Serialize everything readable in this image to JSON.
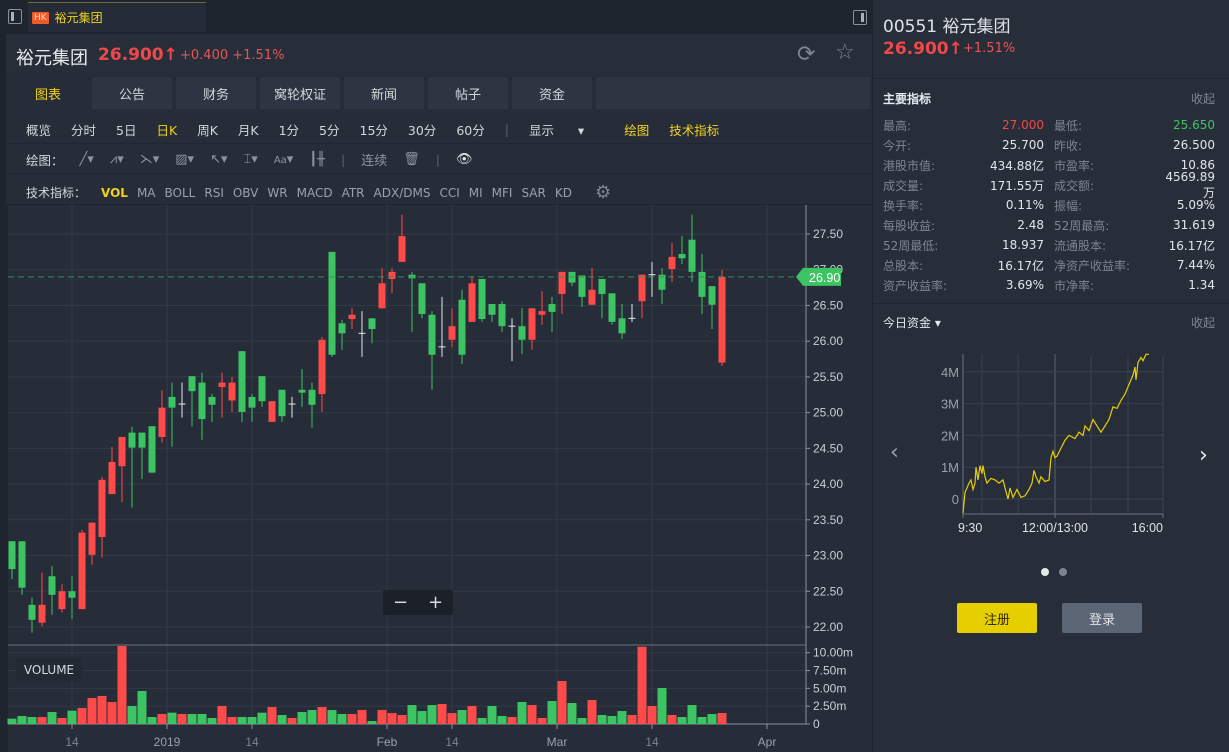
{
  "window_tab": {
    "market_badge": "HK",
    "label": "裕元集团"
  },
  "header": {
    "name": "裕元集团",
    "price": "26.900",
    "arrow": "↑",
    "change": "+0.400",
    "change_pct": "+1.51%"
  },
  "nav_tabs": [
    "图表",
    "公告",
    "财务",
    "窝轮权证",
    "新闻",
    "帖子",
    "资金"
  ],
  "periods": [
    "概览",
    "分时",
    "5日",
    "日K",
    "周K",
    "月K",
    "1分",
    "5分",
    "15分",
    "30分",
    "60分"
  ],
  "period_active": "日K",
  "toolbar": {
    "display": "显示",
    "draw": "绘图",
    "indicators": "技术指标"
  },
  "draw_row": {
    "label": "绘图：",
    "continuous": "连续",
    "font_size_tool": "Aa"
  },
  "indicator_row": {
    "label": "技术指标：",
    "items": [
      "VOL",
      "MA",
      "BOLL",
      "RSI",
      "OBV",
      "WR",
      "MACD",
      "ATR",
      "ADX/DMS",
      "CCI",
      "MI",
      "MFI",
      "SAR",
      "KD"
    ],
    "active": "VOL"
  },
  "volume_label": "VOLUME",
  "zoom": {
    "minus": "−",
    "plus": "+"
  },
  "colors": {
    "up": "#ff4a4a",
    "down": "#3cc462",
    "accent": "#f2d21c",
    "last_price_tag": "#3cc462"
  },
  "chart_data": {
    "type": "candlestick",
    "last_price": 26.9,
    "last_price_label": "26.90",
    "price_ticks": [
      "27.50",
      "27.00",
      "26.50",
      "26.00",
      "25.50",
      "25.00",
      "24.50",
      "24.00",
      "23.50",
      "23.00",
      "22.50",
      "22.00"
    ],
    "volume_ticks": [
      "10.00m",
      "7.50m",
      "5.00m",
      "2.50m",
      "0"
    ],
    "x_ticks": [
      "14",
      "2019",
      "14",
      "Feb",
      "14",
      "Mar",
      "14",
      "Apr"
    ],
    "ohlc": [
      [
        23.2,
        23.2,
        22.67,
        22.81
      ],
      [
        23.2,
        23.2,
        22.45,
        22.55
      ],
      [
        22.31,
        22.41,
        21.92,
        22.1
      ],
      [
        22.06,
        22.76,
        22.01,
        22.31
      ],
      [
        22.71,
        22.85,
        22.17,
        22.45
      ],
      [
        22.25,
        22.6,
        22.2,
        22.5
      ],
      [
        22.5,
        22.71,
        22.11,
        22.41
      ],
      [
        22.25,
        23.36,
        22.25,
        23.32
      ],
      [
        23.01,
        23.46,
        22.87,
        23.46
      ],
      [
        23.26,
        24.1,
        22.97,
        24.06
      ],
      [
        23.86,
        24.52,
        23.86,
        24.31
      ],
      [
        24.25,
        24.66,
        23.75,
        24.66
      ],
      [
        24.72,
        24.8,
        23.67,
        24.51
      ],
      [
        24.72,
        24.72,
        24.07,
        24.51
      ],
      [
        24.81,
        24.81,
        24.16,
        24.16
      ],
      [
        24.66,
        25.31,
        24.58,
        25.07
      ],
      [
        25.22,
        25.42,
        24.52,
        25.07
      ],
      [
        25.12,
        25.42,
        24.93,
        25.12
      ],
      [
        25.51,
        25.51,
        24.81,
        25.3
      ],
      [
        25.42,
        25.56,
        24.62,
        24.91
      ],
      [
        25.22,
        25.26,
        24.87,
        25.11
      ],
      [
        25.36,
        25.56,
        24.93,
        25.42
      ],
      [
        25.17,
        25.5,
        25.01,
        25.42
      ],
      [
        25.86,
        25.86,
        24.87,
        25.01
      ],
      [
        25.22,
        25.26,
        24.87,
        25.07
      ],
      [
        25.51,
        25.51,
        25.08,
        25.16
      ],
      [
        24.87,
        25.16,
        24.87,
        25.16
      ],
      [
        25.32,
        25.32,
        24.87,
        24.95
      ],
      [
        25.12,
        25.22,
        24.93,
        25.12
      ],
      [
        25.32,
        25.61,
        25.08,
        25.28
      ],
      [
        25.32,
        25.42,
        24.79,
        25.11
      ],
      [
        25.26,
        26.06,
        25.01,
        26.02
      ],
      [
        27.25,
        27.25,
        25.78,
        25.81
      ],
      [
        26.25,
        26.3,
        25.88,
        26.11
      ],
      [
        26.31,
        26.46,
        26.17,
        26.37
      ],
      [
        26.11,
        26.42,
        25.78,
        26.11
      ],
      [
        26.32,
        26.32,
        25.97,
        26.17
      ],
      [
        26.46,
        27.02,
        26.46,
        26.81
      ],
      [
        26.87,
        27.02,
        26.67,
        26.97
      ],
      [
        27.11,
        27.77,
        27.11,
        27.47
      ],
      [
        26.93,
        26.97,
        26.13,
        26.88
      ],
      [
        26.81,
        26.81,
        26.32,
        26.38
      ],
      [
        26.37,
        26.42,
        25.32,
        25.81
      ],
      [
        25.92,
        26.62,
        25.78,
        25.92
      ],
      [
        26.02,
        26.46,
        25.92,
        26.21
      ],
      [
        26.58,
        26.72,
        25.68,
        25.81
      ],
      [
        26.27,
        26.91,
        26.27,
        26.81
      ],
      [
        26.87,
        26.87,
        26.27,
        26.31
      ],
      [
        26.52,
        26.52,
        26.27,
        26.37
      ],
      [
        26.52,
        26.56,
        26.13,
        26.21
      ],
      [
        26.21,
        26.32,
        25.72,
        26.21
      ],
      [
        26.21,
        26.46,
        25.82,
        26.02
      ],
      [
        26.02,
        26.46,
        25.88,
        26.46
      ],
      [
        26.37,
        26.7,
        26.23,
        26.42
      ],
      [
        26.52,
        26.62,
        26.13,
        26.41
      ],
      [
        26.66,
        26.97,
        26.38,
        26.97
      ],
      [
        26.97,
        26.97,
        26.77,
        26.82
      ],
      [
        26.92,
        26.92,
        26.48,
        26.62
      ],
      [
        26.51,
        27.02,
        26.51,
        26.72
      ],
      [
        26.87,
        26.87,
        26.32,
        26.66
      ],
      [
        26.67,
        26.67,
        26.23,
        26.27
      ],
      [
        26.32,
        26.52,
        26.03,
        26.11
      ],
      [
        26.32,
        26.52,
        26.27,
        26.32
      ],
      [
        26.56,
        26.93,
        26.32,
        26.93
      ],
      [
        26.93,
        27.11,
        26.62,
        26.93
      ],
      [
        26.93,
        27.02,
        26.52,
        26.72
      ],
      [
        27.01,
        27.37,
        26.83,
        27.18
      ],
      [
        27.22,
        27.47,
        27.08,
        27.16
      ],
      [
        27.42,
        27.77,
        26.83,
        26.97
      ],
      [
        26.97,
        27.22,
        26.38,
        26.62
      ],
      [
        26.77,
        26.77,
        26.17,
        26.51
      ],
      [
        25.7,
        27.0,
        25.65,
        26.9
      ]
    ],
    "volume_m": [
      0.75,
      1.12,
      0.98,
      0.98,
      1.68,
      0.84,
      1.87,
      2.24,
      3.64,
      3.93,
      3.08,
      11.07,
      2.52,
      4.63,
      0.98,
      1.4,
      1.59,
      1.4,
      1.4,
      1.4,
      0.84,
      2.52,
      0.98,
      0.98,
      0.98,
      1.59,
      2.38,
      1.26,
      0.84,
      1.68,
      1.96,
      2.38,
      1.96,
      1.4,
      1.4,
      1.96,
      0.42,
      1.96,
      1.54,
      1.26,
      2.66,
      1.82,
      2.66,
      2.8,
      1.54,
      1.96,
      2.52,
      0.84,
      2.52,
      1.12,
      0.98,
      3.08,
      2.66,
      0.84,
      3.22,
      6.03,
      2.94,
      0.84,
      3.36,
      1.26,
      1.12,
      1.82,
      1.26,
      10.84,
      2.52,
      5.05,
      1.26,
      0.98,
      2.66,
      0.98,
      1.4,
      1.54
    ],
    "ylim": [
      21.8,
      27.9
    ],
    "fund_flow": {
      "title": "今日资金",
      "y_ticks": [
        "4M",
        "3M",
        "2M",
        "1M",
        "0"
      ],
      "x_ticks": [
        "9:30",
        "12:00/13:00",
        "16:00"
      ],
      "ylim": [
        -0.47,
        4.56
      ],
      "points": [
        [
          0,
          -0.45
        ],
        [
          0.01,
          0.2
        ],
        [
          0.03,
          0.5
        ],
        [
          0.04,
          0.6
        ],
        [
          0.05,
          0.3
        ],
        [
          0.06,
          0.5
        ],
        [
          0.065,
          1.0
        ],
        [
          0.075,
          0.6
        ],
        [
          0.085,
          1.05
        ],
        [
          0.095,
          0.8
        ],
        [
          0.1,
          1.05
        ],
        [
          0.11,
          0.7
        ],
        [
          0.12,
          0.5
        ],
        [
          0.14,
          0.65
        ],
        [
          0.16,
          0.6
        ],
        [
          0.18,
          0.5
        ],
        [
          0.2,
          0.6
        ],
        [
          0.21,
          0.35
        ],
        [
          0.225,
          0.0
        ],
        [
          0.235,
          0.35
        ],
        [
          0.25,
          0.05
        ],
        [
          0.27,
          0.3
        ],
        [
          0.29,
          0.05
        ],
        [
          0.31,
          0.1
        ],
        [
          0.33,
          0.3
        ],
        [
          0.345,
          0.5
        ],
        [
          0.355,
          0.9
        ],
        [
          0.365,
          0.7
        ],
        [
          0.38,
          0.5
        ],
        [
          0.39,
          0.7
        ],
        [
          0.41,
          0.55
        ],
        [
          0.43,
          0.6
        ],
        [
          0.44,
          1.3
        ],
        [
          0.45,
          1.5
        ],
        [
          0.46,
          1.3
        ],
        [
          0.47,
          1.35
        ],
        [
          0.49,
          1.6
        ],
        [
          0.51,
          1.85
        ],
        [
          0.53,
          2.0
        ],
        [
          0.56,
          1.9
        ],
        [
          0.58,
          2.1
        ],
        [
          0.6,
          2.0
        ],
        [
          0.61,
          2.3
        ],
        [
          0.63,
          2.15
        ],
        [
          0.65,
          2.5
        ],
        [
          0.67,
          2.3
        ],
        [
          0.69,
          2.1
        ],
        [
          0.71,
          2.3
        ],
        [
          0.73,
          2.5
        ],
        [
          0.75,
          2.9
        ],
        [
          0.77,
          2.85
        ],
        [
          0.79,
          3.1
        ],
        [
          0.81,
          3.3
        ],
        [
          0.83,
          3.6
        ],
        [
          0.85,
          3.9
        ],
        [
          0.86,
          4.15
        ],
        [
          0.865,
          3.75
        ],
        [
          0.875,
          4.3
        ],
        [
          0.89,
          4.45
        ],
        [
          0.9,
          4.35
        ],
        [
          0.915,
          4.55
        ],
        [
          0.93,
          4.55
        ]
      ]
    }
  },
  "side": {
    "code_name": "00551 裕元集团",
    "price": "26.900",
    "arrow": "↑",
    "change_pct": "+1.51%",
    "key_metrics_title": "主要指标",
    "collapse": "收起",
    "stats": [
      [
        "最高:",
        "27.000",
        "最低:",
        "25.650"
      ],
      [
        "今开:",
        "25.700",
        "昨收:",
        "26.500"
      ],
      [
        "港股市值:",
        "434.88亿",
        "市盈率:",
        "10.86"
      ],
      [
        "成交量:",
        "171.55万",
        "成交额:",
        "4569.89万"
      ],
      [
        "换手率:",
        "0.11%",
        "振幅:",
        "5.09%"
      ],
      [
        "每股收益:",
        "2.48",
        "52周最高:",
        "31.619"
      ],
      [
        "52周最低:",
        "18.937",
        "流通股本:",
        "16.17亿"
      ],
      [
        "总股本:",
        "16.17亿",
        "净资产收益率:",
        "7.44%"
      ],
      [
        "资产收益率:",
        "3.69%",
        "市净率:",
        "1.34"
      ]
    ],
    "fund_title": "今日资金",
    "fund_collapse": "收起",
    "register": "注册",
    "login": "登录"
  }
}
